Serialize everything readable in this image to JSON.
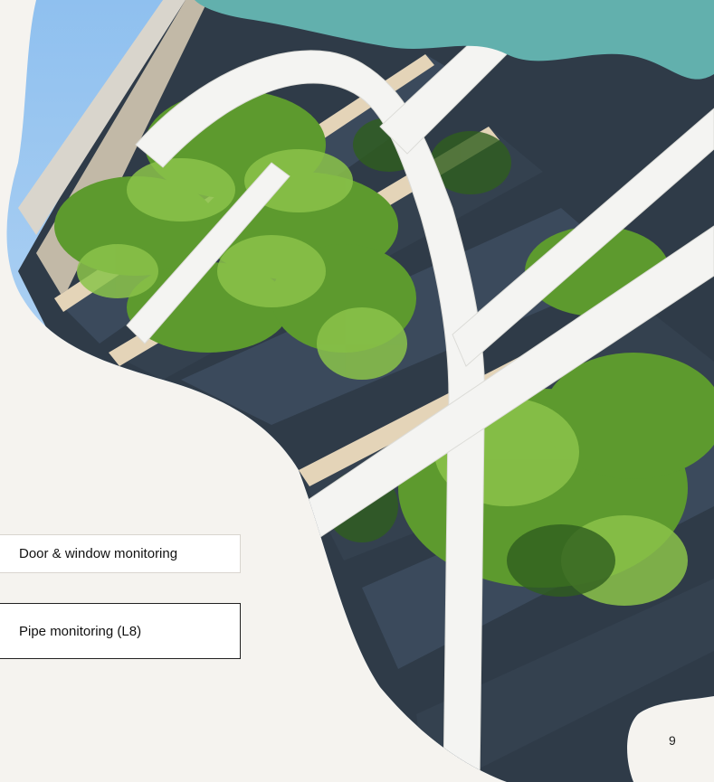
{
  "nav": {
    "door_window": "Door & window monitoring",
    "pipe": "Pipe monitoring (L8)"
  },
  "page_number": "9",
  "colors": {
    "background": "#f5f3ef",
    "teal_accent": "#62b0ad",
    "sky": "#a9cdf0",
    "foliage": "#4f8a2a",
    "planter_box": "#3b4a5c",
    "white_frame": "#f4f4f2"
  }
}
